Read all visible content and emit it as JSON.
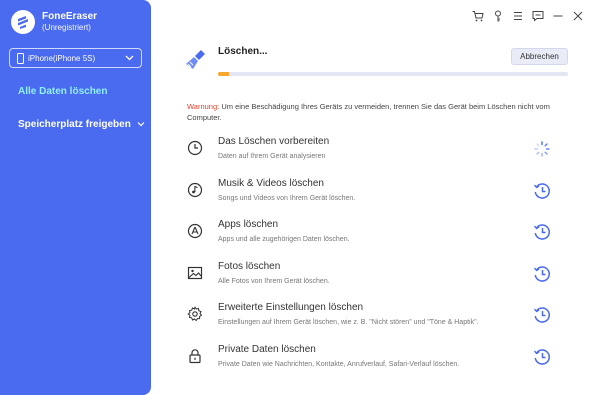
{
  "brand": {
    "name": "FoneEraser",
    "subtitle": "(Unregistriert)"
  },
  "device": {
    "selected": "iPhone(iPhone 5S)"
  },
  "nav": {
    "items": [
      {
        "label": "Alle Daten löschen"
      },
      {
        "label": "Speicherplatz freigeben"
      }
    ]
  },
  "topbar": {
    "icons": [
      "cart-icon",
      "key-icon",
      "menu-icon",
      "feedback-icon",
      "minimize-icon",
      "close-icon"
    ]
  },
  "status": {
    "title": "Löschen...",
    "cancel_label": "Abbrechen",
    "progress": 0.03
  },
  "warning": {
    "label": "Warnung:",
    "text": " Um eine Beschädigung Ihres Geräts zu vermeiden, trennen Sie das Gerät beim Löschen nicht vom Computer."
  },
  "tasks": [
    {
      "title": "Das Löschen vorbereiten",
      "desc": "Daten auf Ihrem Gerät analysieren",
      "icon": "clock-icon",
      "state": "in-progress"
    },
    {
      "title": "Musik & Videos löschen",
      "desc": "Songs und Videos von Ihrem Gerät löschen.",
      "icon": "music-icon",
      "state": "pending"
    },
    {
      "title": "Apps löschen",
      "desc": "Apps und alle zugehörigen Daten löschen.",
      "icon": "app-store-icon",
      "state": "pending"
    },
    {
      "title": "Fotos löschen",
      "desc": "Alle Fotos von Ihrem Gerät löschen.",
      "icon": "photo-icon",
      "state": "pending"
    },
    {
      "title": "Erweiterte Einstellungen löschen",
      "desc": "Einstellungen auf Ihrem Gerät löschen, wie z. B. \"Nicht stören\" und \"Töne & Haptik\".",
      "icon": "settings-icon",
      "state": "pending"
    },
    {
      "title": "Private Daten löschen",
      "desc": "Private Daten wie Nachrichten, Kontakte, Anrufverlauf, Safari-Verlauf löschen.",
      "icon": "lock-icon",
      "state": "pending"
    }
  ],
  "colors": {
    "sidebar": "#4a6af0",
    "accent": "#4a6af0",
    "active_nav": "#8ff0ff",
    "warning": "#e8412a",
    "progress": "#f7a72a"
  }
}
